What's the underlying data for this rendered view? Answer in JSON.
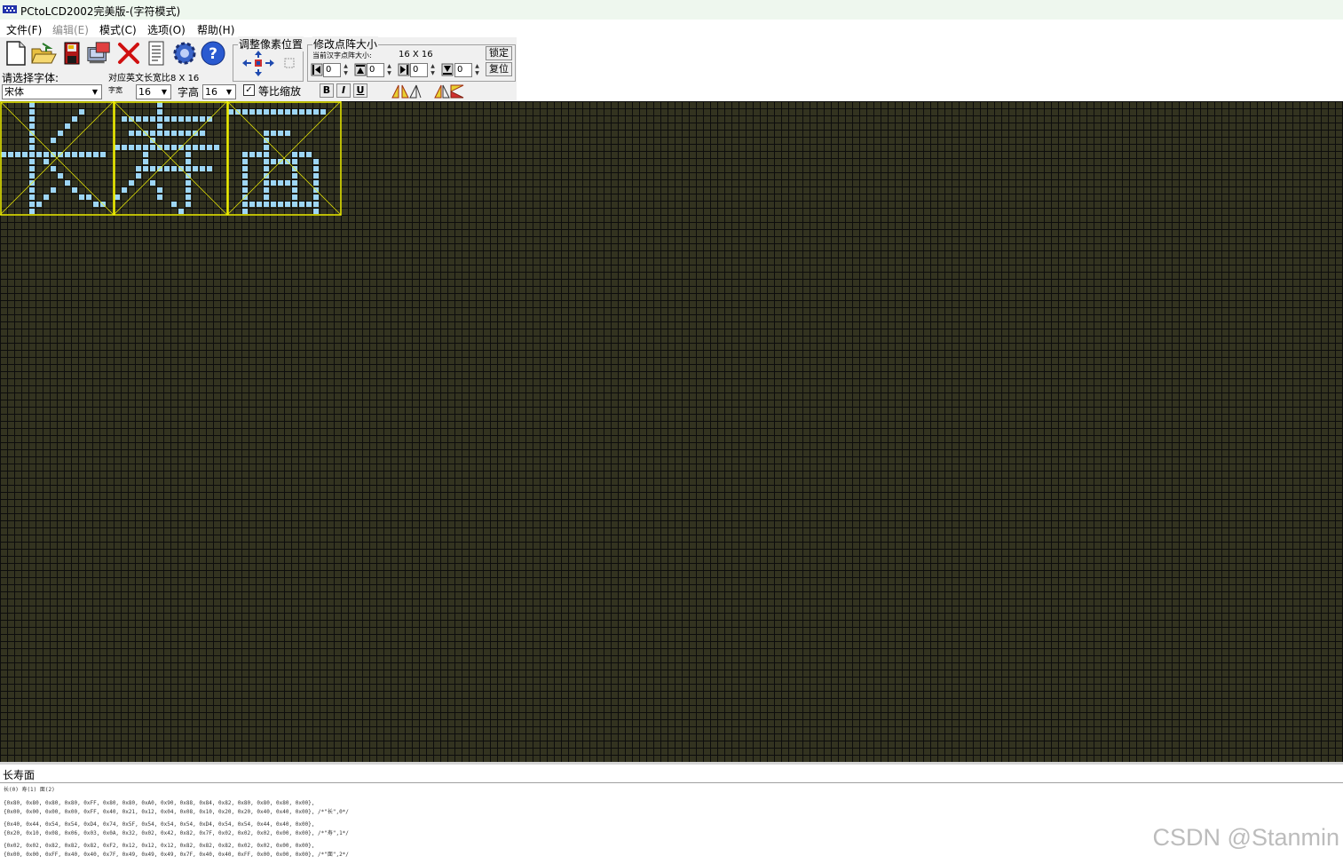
{
  "window": {
    "title": "PCtoLCD2002完美版-(字符模式)"
  },
  "menu": [
    {
      "label": "文件(F)",
      "enabled": true
    },
    {
      "label": "编辑(E)",
      "enabled": false
    },
    {
      "label": "模式(C)",
      "enabled": true
    },
    {
      "label": "选项(O)",
      "enabled": true
    },
    {
      "label": "帮助(H)",
      "enabled": true
    }
  ],
  "toolbar": {
    "adjust_group_label": "调整像素位置",
    "resize_group_label": "修改点阵大小",
    "current_size_label": "当前汉字点阵大小:",
    "current_size_value": "16 X 16",
    "lock_button": "锁定",
    "reset_button": "复位",
    "spin_values": [
      "0",
      "0",
      "0",
      "0"
    ]
  },
  "font": {
    "select_label": "请选择字体:",
    "font_name": "宋体",
    "english_ratio_label": "对应英文长宽比8 X 16",
    "width_label": "字宽",
    "width_value": "16",
    "height_label": "字高",
    "height_value": "16",
    "proportional_label": "等比缩放",
    "proportional_checked": true,
    "bold_label": "B",
    "italic_label": "I",
    "underline_label": "U"
  },
  "colors": {
    "grid_background": "#333320",
    "pixel_on": "#9ed6f5",
    "selection_box": "#f0f000"
  },
  "input_text": "长寿面",
  "output": {
    "index_line": "长(0) 寿(1) 面(2)",
    "lines": [
      "{0x80, 0x80, 0x80, 0x80, 0xFF, 0x80, 0x80, 0xA0, 0x90, 0x88, 0x84, 0x82, 0x80, 0x80, 0x80, 0x00},",
      "{0x00, 0x00, 0x00, 0x00, 0xFF, 0x40, 0x21, 0x12, 0x04, 0x08, 0x10, 0x20, 0x20, 0x40, 0x40, 0x00}, /*\"长\",0*/",
      "",
      "{0x40, 0x44, 0x54, 0x54, 0xD4, 0x74, 0x5F, 0x54, 0x54, 0x54, 0xD4, 0x54, 0x54, 0x44, 0x40, 0x00},",
      "{0x20, 0x10, 0x08, 0x06, 0x03, 0x0A, 0x32, 0x02, 0x42, 0x82, 0x7F, 0x02, 0x02, 0x02, 0x00, 0x00}, /*\"寿\",1*/",
      "",
      "{0x02, 0x02, 0x82, 0x82, 0x82, 0xF2, 0x12, 0x12, 0x12, 0x82, 0x82, 0x82, 0x02, 0x02, 0x00, 0x00},",
      "{0x00, 0x00, 0xFF, 0x40, 0x40, 0x7F, 0x49, 0x49, 0x49, 0x7F, 0x40, 0x40, 0xFF, 0x00, 0x00, 0x00}, /*\"面\",2*/"
    ]
  },
  "watermark": "CSDN @Stanmin"
}
